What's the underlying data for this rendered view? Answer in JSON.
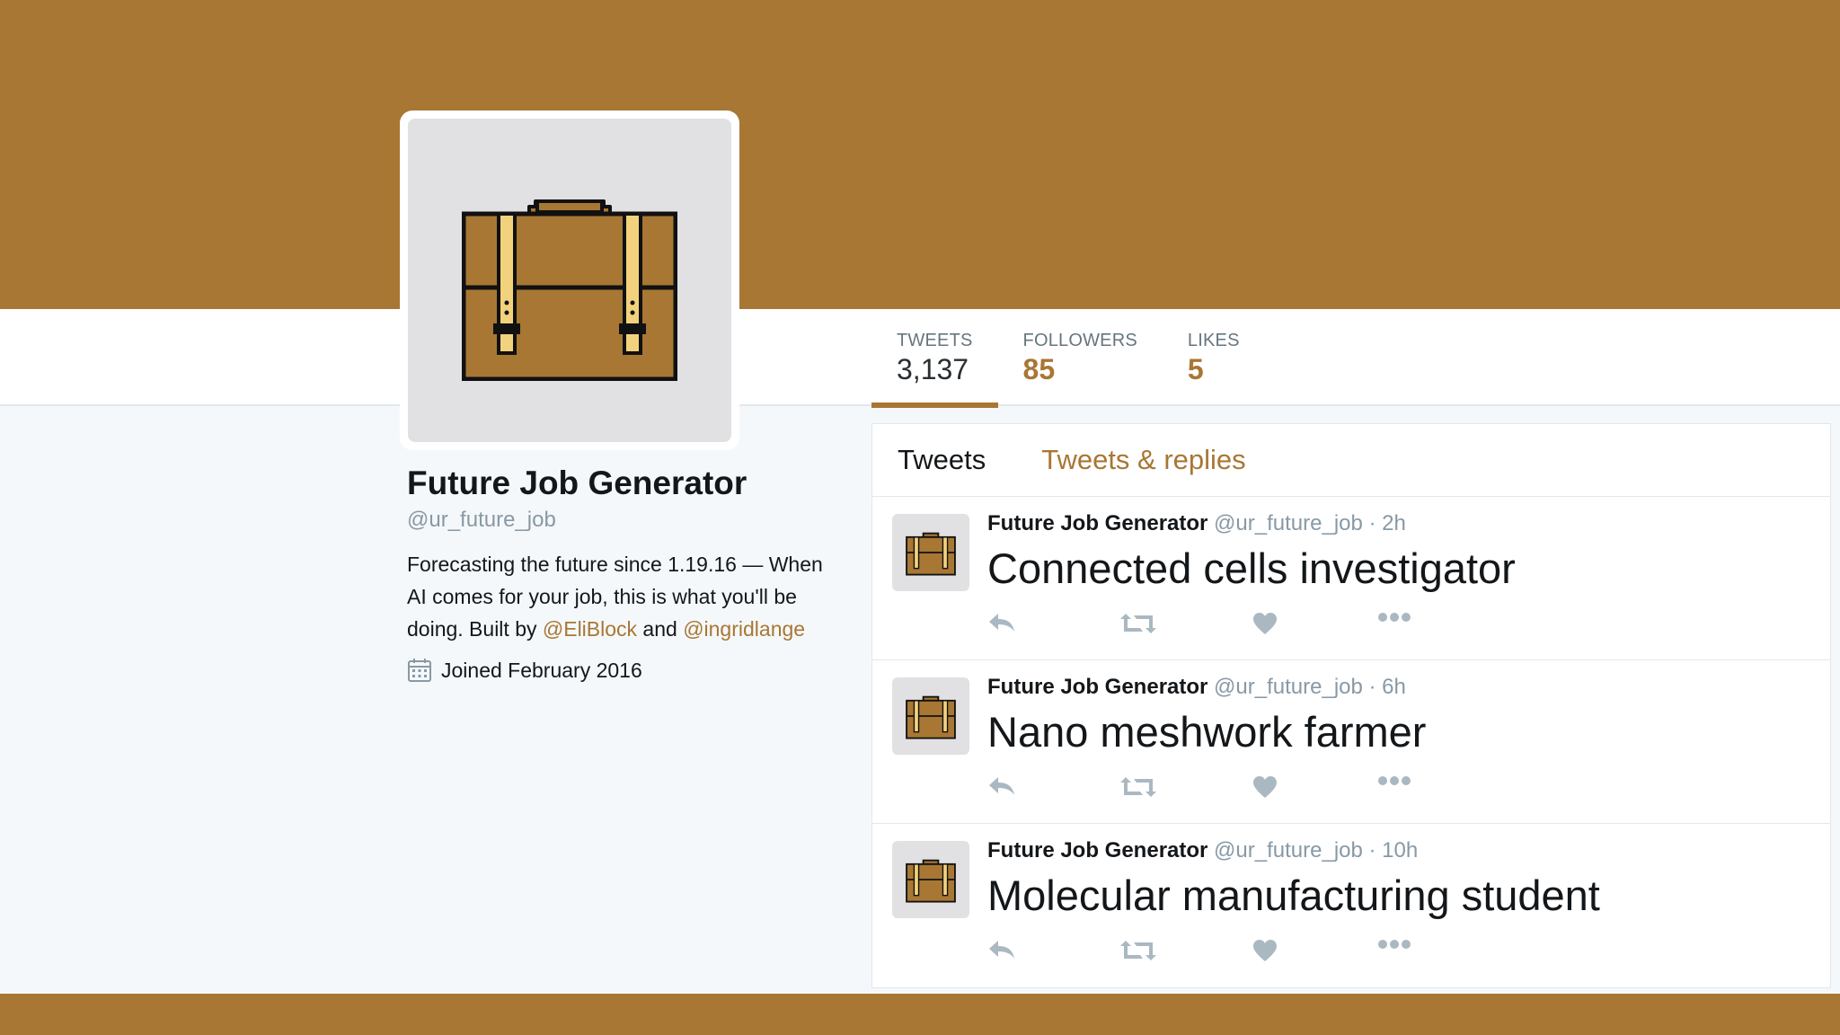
{
  "profile": {
    "name": "Future Job Generator",
    "handle": "@ur_future_job",
    "bio_prefix": "Forecasting the future since 1.19.16 — When AI comes for your job, this is what you'll be doing. Built by ",
    "bio_link1": "@EliBlock",
    "bio_middle": " and ",
    "bio_link2": "@ingridlange",
    "joined": "Joined February 2016"
  },
  "stats": [
    {
      "label": "TWEETS",
      "value": "3,137"
    },
    {
      "label": "FOLLOWERS",
      "value": "85"
    },
    {
      "label": "LIKES",
      "value": "5"
    }
  ],
  "tabs": [
    {
      "label": "Tweets"
    },
    {
      "label": "Tweets & replies"
    }
  ],
  "tweets": [
    {
      "author": "Future Job Generator",
      "meta": " @ur_future_job · 2h",
      "text": "Connected cells investigator"
    },
    {
      "author": "Future Job Generator",
      "meta": " @ur_future_job · 6h",
      "text": "Nano meshwork farmer"
    },
    {
      "author": "Future Job Generator",
      "meta": " @ur_future_job · 10h",
      "text": "Molecular manufacturing student"
    }
  ],
  "colors": {
    "brand": "#a87734",
    "strap": "#f2d27c",
    "avatar_bg": "#e1e1e3"
  },
  "icons": {
    "avatar": "briefcase-icon",
    "joined": "calendar-icon",
    "actions": [
      "reply-icon",
      "retweet-icon",
      "heart-icon",
      "more-icon"
    ]
  }
}
